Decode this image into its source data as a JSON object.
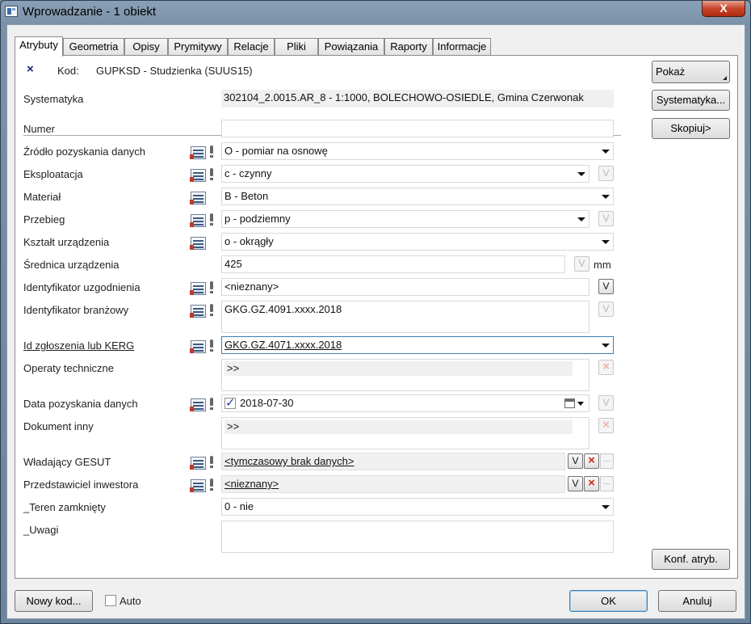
{
  "window": {
    "title": "Wprowadzanie - 1 obiekt",
    "close_glyph": "X"
  },
  "tabs": [
    {
      "label": "Atrybuty",
      "active": true
    },
    {
      "label": "Geometria"
    },
    {
      "label": "Opisy"
    },
    {
      "label": "Prymitywy"
    },
    {
      "label": "Relacje"
    },
    {
      "label": "Pliki"
    },
    {
      "label": "Powiązania"
    },
    {
      "label": "Raporty"
    },
    {
      "label": "Informacje"
    }
  ],
  "header": {
    "close_mark": "×",
    "kod_label": "Kod:",
    "kod_value": "GUPKSD - Studzienka (SUUS15)",
    "systematyka_label": "Systematyka",
    "systematyka_value": "302104_2.0015.AR_8 - 1:1000, BOLECHOWO-OSIEDLE, Gmina Czerwonak"
  },
  "fields": {
    "numer": {
      "label": "Numer",
      "value": ""
    },
    "zrodlo": {
      "label": "Źródło pozyskania danych",
      "value": "O - pomiar na osnowę"
    },
    "eksploatacja": {
      "label": "Eksploatacja",
      "value": "c - czynny"
    },
    "material": {
      "label": "Materiał",
      "value": "B - Beton"
    },
    "przebieg": {
      "label": "Przebieg",
      "value": "p - podziemny"
    },
    "ksztalt": {
      "label": "Kształt urządzenia",
      "value": "o - okrągły"
    },
    "srednica": {
      "label": "Średnica urządzenia",
      "value": "425",
      "unit": "mm"
    },
    "id_uzgodnienia": {
      "label": "Identyfikator uzgodnienia",
      "value": "<nieznany>"
    },
    "id_branzowy": {
      "label": "Identyfikator branżowy",
      "value": "GKG.GZ.4091.xxxx.2018"
    },
    "id_zgloszenia": {
      "label": "Id zgłoszenia lub KERG",
      "value": "GKG.GZ.4071.xxxx.2018"
    },
    "operaty": {
      "label": "Operaty techniczne",
      "value": ">>"
    },
    "data_pozyskania": {
      "label": "Data pozyskania danych",
      "value": "2018-07-30",
      "checked": true
    },
    "dokument_inny": {
      "label": "Dokument inny",
      "value": ">>"
    },
    "wladajacy": {
      "label": "Władający GESUT",
      "value": "<tymczasowy brak danych>"
    },
    "przedstawiciel": {
      "label": "Przedstawiciel inwestora",
      "value": "<nieznany>"
    },
    "teren": {
      "label": "_Teren zamknięty",
      "value": "0 - nie"
    },
    "uwagi": {
      "label": "_Uwagi",
      "value": ""
    }
  },
  "glyphs": {
    "v": "V",
    "x": "×",
    "dots": "..."
  },
  "side_buttons": {
    "pokaz": "Pokaż",
    "systematyka": "Systematyka...",
    "skopiuj": "Skopiuj>",
    "konf": "Konf. atryb."
  },
  "footer": {
    "nowy_kod": "Nowy kod...",
    "auto_label": "Auto",
    "auto_checked": false,
    "ok": "OK",
    "anuluj": "Anuluj"
  }
}
